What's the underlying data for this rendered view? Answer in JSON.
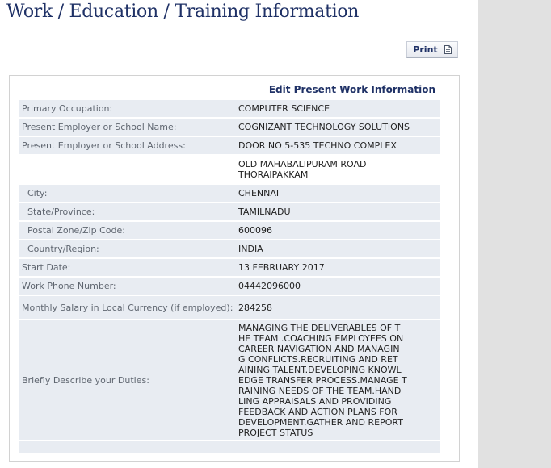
{
  "page": {
    "title": "Work / Education / Training Information"
  },
  "toolbar": {
    "print_label": "Print",
    "print_icon": "document-icon"
  },
  "panel": {
    "edit_link": "Edit Present Work Information"
  },
  "fields": {
    "occupation_label": "Primary Occupation:",
    "occupation_value": "COMPUTER SCIENCE",
    "employer_label": "Present Employer or School Name:",
    "employer_value": "COGNIZANT TECHNOLOGY SOLUTIONS",
    "address_label": "Present Employer or School Address:",
    "address_line1": "DOOR NO 5-535 TECHNO COMPLEX",
    "address_line2": "OLD MAHABALIPURAM ROAD",
    "address_line3": "THORAIPAKKAM",
    "city_label": "City:",
    "city_value": "CHENNAI",
    "state_label": "State/Province:",
    "state_value": "TAMILNADU",
    "postal_label": "Postal Zone/Zip Code:",
    "postal_value": "600096",
    "country_label": "Country/Region:",
    "country_value": "INDIA",
    "start_label": "Start Date:",
    "start_value": "13 FEBRUARY 2017",
    "phone_label": "Work Phone Number:",
    "phone_value": "04442096000",
    "salary_label": "Monthly Salary in Local Currency (if employed):",
    "salary_value": "284258",
    "duties_label": "Briefly Describe your Duties:",
    "duties_lines": [
      "MANAGING THE DELIVERABLES OF T",
      "HE TEAM .COACHING EMPLOYEES ON",
      "CAREER NAVIGATION AND MANAGIN",
      "G CONFLICTS.RECRUITING AND RET",
      "AINING TALENT.DEVELOPING KNOWL",
      "EDGE TRANSFER PROCESS.MANAGE T",
      "RAINING NEEDS OF THE TEAM.HAND",
      "LING APPRAISALS AND PROVIDING",
      "FEEDBACK AND ACTION PLANS FOR",
      "DEVELOPMENT.GATHER AND REPORT",
      "PROJECT STATUS"
    ]
  },
  "colors": {
    "title": "#1f3166",
    "row_shade": "#e8ecf2",
    "label_text": "#5f6670",
    "gutter": "#e1e1e1"
  }
}
